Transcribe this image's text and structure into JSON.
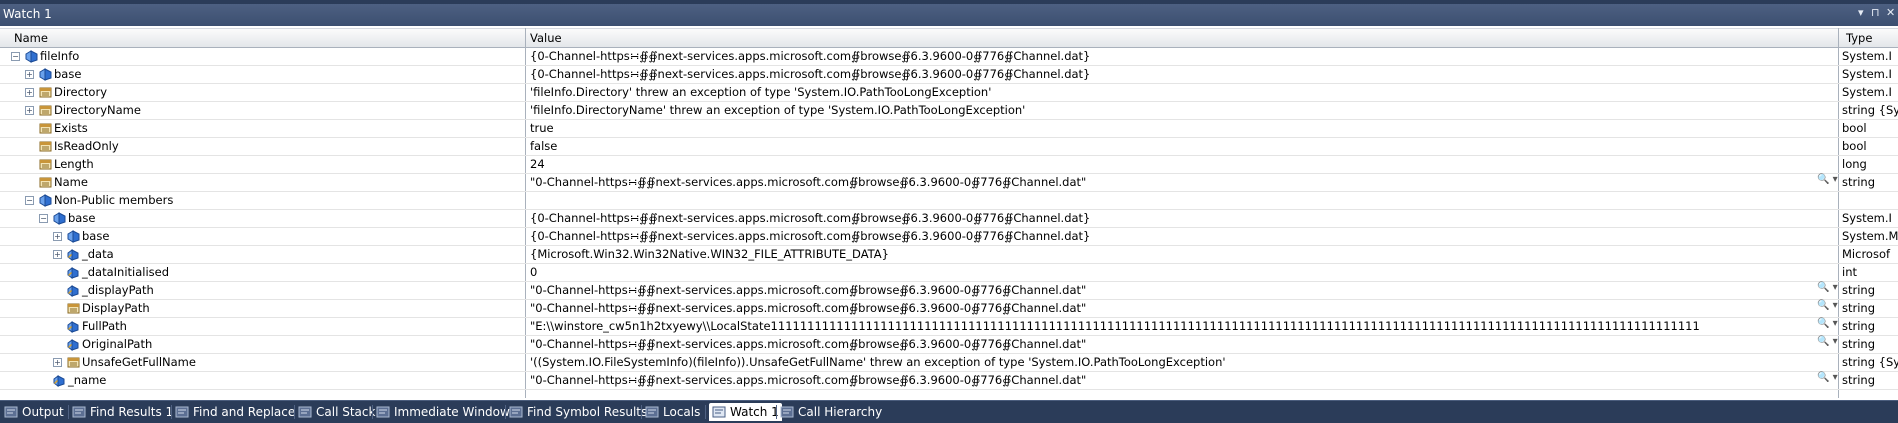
{
  "window": {
    "title": "Watch 1",
    "controls": [
      "▾",
      "⊓",
      "✕"
    ]
  },
  "columns": {
    "name": "Name",
    "value": "Value",
    "type": "Type"
  },
  "rows": [
    {
      "name": "fileInfo",
      "value": "{0-Channel-https∺∯∯next-services.apps.microsoft.com∯browse∯6.3.9600-0∯776∯Channel.dat}",
      "type": "System.I",
      "expander": "−",
      "icon": "field"
    },
    {
      "name": "base",
      "value": "{0-Channel-https∺∯∯next-services.apps.microsoft.com∯browse∯6.3.9600-0∯776∯Channel.dat}",
      "type": "System.I",
      "expander": "+",
      "icon": "field"
    },
    {
      "name": "Directory",
      "value": "'fileInfo.Directory' threw an exception of type 'System.IO.PathTooLongException'",
      "type": "System.I",
      "expander": "+",
      "icon": "property"
    },
    {
      "name": "DirectoryName",
      "value": "'fileInfo.DirectoryName' threw an exception of type 'System.IO.PathTooLongException'",
      "type": "string {Sy",
      "expander": "+",
      "icon": "property"
    },
    {
      "name": "Exists",
      "value": "true",
      "type": "bool",
      "expander": "",
      "icon": "property"
    },
    {
      "name": "IsReadOnly",
      "value": "false",
      "type": "bool",
      "expander": "",
      "icon": "property"
    },
    {
      "name": "Length",
      "value": "24",
      "type": "long",
      "expander": "",
      "icon": "property"
    },
    {
      "name": "Name",
      "value": "\"0-Channel-https∺∯∯next-services.apps.microsoft.com∯browse∯6.3.9600-0∯776∯Channel.dat\"",
      "type": "string",
      "expander": "",
      "icon": "property",
      "magnifier": "🔍 ▾"
    },
    {
      "name": "Non-Public members",
      "value": "",
      "type": "",
      "expander": "−",
      "icon": "field"
    },
    {
      "name": "base",
      "value": "{0-Channel-https∺∯∯next-services.apps.microsoft.com∯browse∯6.3.9600-0∯776∯Channel.dat}",
      "type": "System.I",
      "expander": "−",
      "icon": "field"
    },
    {
      "name": "base",
      "value": "{0-Channel-https∺∯∯next-services.apps.microsoft.com∯browse∯6.3.9600-0∯776∯Channel.dat}",
      "type": "System.M",
      "expander": "+",
      "icon": "field"
    },
    {
      "name": "_data",
      "value": "{Microsoft.Win32.Win32Native.WIN32_FILE_ATTRIBUTE_DATA}",
      "type": "Microsof",
      "expander": "+",
      "icon": "private-field"
    },
    {
      "name": "_dataInitialised",
      "value": "0",
      "type": "int",
      "expander": "",
      "icon": "private-field"
    },
    {
      "name": "_displayPath",
      "value": "\"0-Channel-https∺∯∯next-services.apps.microsoft.com∯browse∯6.3.9600-0∯776∯Channel.dat\"",
      "type": "string",
      "expander": "",
      "icon": "private-field",
      "magnifier": "🔍 ▾"
    },
    {
      "name": "DisplayPath",
      "value": "\"0-Channel-https∺∯∯next-services.apps.microsoft.com∯browse∯6.3.9600-0∯776∯Channel.dat\"",
      "type": "string",
      "expander": "",
      "icon": "property",
      "magnifier": "🔍 ▾"
    },
    {
      "name": "FullPath",
      "value": "\"E:\\\\winstore_cw5n1h2txyewy\\\\LocalState1111111111111111111111111111111111111111111111111111111111111111111111111111111111111111111111111111111111111111111111111111111",
      "type": "string",
      "expander": "",
      "icon": "private-field",
      "magnifier": "🔍 ▾"
    },
    {
      "name": "OriginalPath",
      "value": "\"0-Channel-https∺∯∯next-services.apps.microsoft.com∯browse∯6.3.9600-0∯776∯Channel.dat\"",
      "type": "string",
      "expander": "",
      "icon": "private-field",
      "magnifier": "🔍 ▾"
    },
    {
      "name": "UnsafeGetFullName",
      "value": "'((System.IO.FileSystemInfo)(fileInfo)).UnsafeGetFullName' threw an exception of type 'System.IO.PathTooLongException'",
      "type": "string {Sy",
      "expander": "+",
      "icon": "property"
    },
    {
      "name": "_name",
      "value": "\"0-Channel-https∺∯∯next-services.apps.microsoft.com∯browse∯6.3.9600-0∯776∯Channel.dat\"",
      "type": "string",
      "expander": "",
      "icon": "private-field",
      "magnifier": "🔍 ▾"
    }
  ],
  "tabs": [
    {
      "label": "Output",
      "icon": "output-icon",
      "active": false
    },
    {
      "label": "Find Results 1",
      "icon": "find-results-icon",
      "active": false
    },
    {
      "label": "Find and Replace",
      "icon": "find-replace-icon",
      "active": false
    },
    {
      "label": "Call Stack",
      "icon": "call-stack-icon",
      "active": false
    },
    {
      "label": "Immediate Window",
      "icon": "immediate-window-icon",
      "active": false
    },
    {
      "label": "Find Symbol Results",
      "icon": "find-symbol-icon",
      "active": false
    },
    {
      "label": "Locals",
      "icon": "locals-icon",
      "active": false
    },
    {
      "label": "Watch 1",
      "icon": "watch-icon",
      "active": true
    },
    {
      "label": "Call Hierarchy",
      "icon": "call-hierarchy-icon",
      "active": false
    }
  ],
  "colors": {
    "frame": "#2b3c59",
    "title_bar": "#44577a",
    "field_icon": "#2f6fd0",
    "property_icon": "#c8953a"
  }
}
